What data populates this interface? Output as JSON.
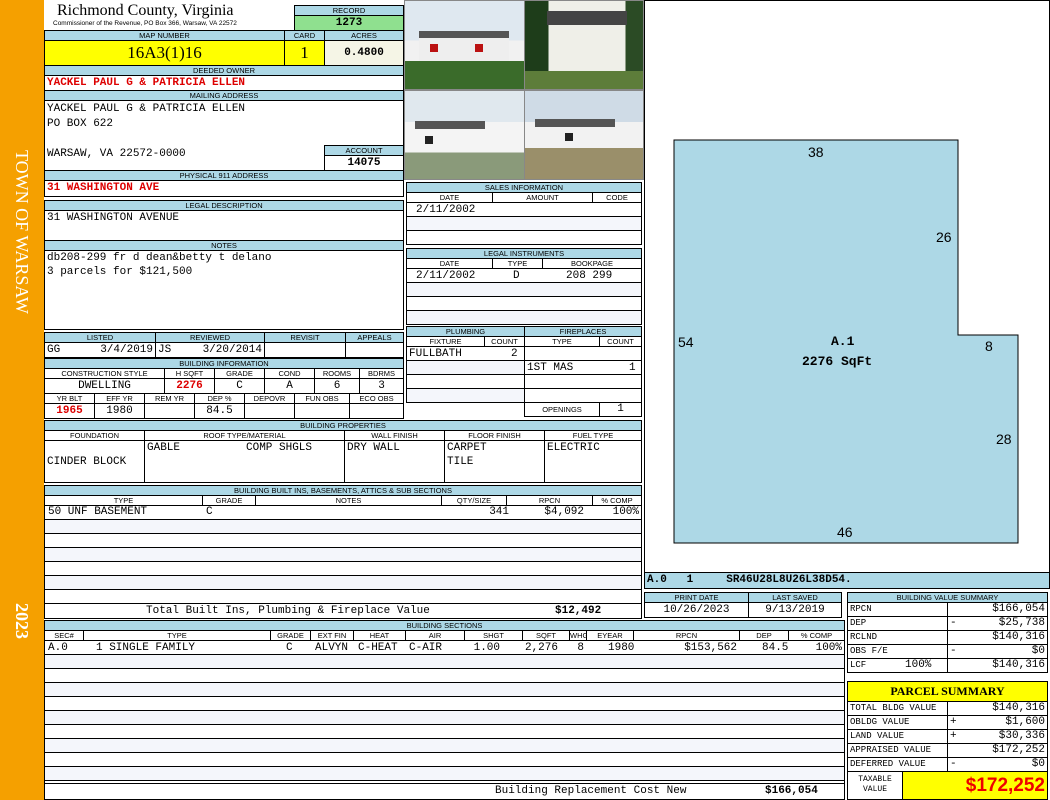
{
  "side": {
    "town": "TOWN OF WARSAW",
    "year": "2023"
  },
  "header": {
    "county": "Richmond County, Virginia",
    "office": "Commissioner of the Revenue, PO Box 366, Warsaw, VA 22572",
    "record_label": "RECORD",
    "record": "1273",
    "map_label": "MAP NUMBER",
    "map": "16A3(1)16",
    "card_label": "CARD",
    "card": "1",
    "acres_label": "ACRES",
    "acres": "0.4800"
  },
  "owner": {
    "label": "DEEDED OWNER",
    "value": "YACKEL PAUL G & PATRICIA ELLEN"
  },
  "mailing": {
    "label": "MAILING ADDRESS",
    "line1": "YACKEL PAUL G & PATRICIA ELLEN",
    "line2": "PO BOX 622",
    "line3": "WARSAW, VA 22572-0000",
    "account_label": "ACCOUNT",
    "account": "14075"
  },
  "physical": {
    "label": "PHYSICAL 911 ADDRESS",
    "value": "31 WASHINGTON AVE"
  },
  "legal": {
    "label": "LEGAL DESCRIPTION",
    "value": "31 WASHINGTON AVENUE"
  },
  "notes": {
    "label": "NOTES",
    "line1": "db208-299 fr d dean&betty t delano",
    "line2": "3 parcels for $121,500"
  },
  "listing": {
    "listed_label": "LISTED",
    "listed_by": "GG",
    "listed_date": "3/4/2019",
    "reviewed_label": "REVIEWED",
    "reviewed_by": "JS",
    "reviewed_date": "3/20/2014",
    "revisit_label": "REVISIT",
    "appeals_label": "APPEALS"
  },
  "bldg_info": {
    "label": "BUILDING INFORMATION",
    "h1": [
      "CONSTRUCTION STYLE",
      "H SQFT",
      "GRADE",
      "COND",
      "ROOMS",
      "BDRMS"
    ],
    "v1": [
      "DWELLING",
      "2276",
      "C",
      "A",
      "6",
      "3"
    ],
    "h2": [
      "YR BLT",
      "EFF YR",
      "REM YR",
      "DEP %",
      "DEPOVR",
      "FUN OBS",
      "ECO OBS"
    ],
    "v2": [
      "1965",
      "1980",
      "",
      "84.5",
      "",
      "",
      ""
    ]
  },
  "props": {
    "label": "BUILDING PROPERTIES",
    "headers": [
      "FOUNDATION",
      "ROOF TYPE/MATERIAL",
      "WALL FINISH",
      "FLOOR FINISH",
      "FUEL TYPE"
    ],
    "foundation": "CINDER BLOCK",
    "roof_type": "GABLE",
    "roof_material": "COMP SHGLS",
    "wall": "DRY WALL",
    "floor1": "CARPET",
    "floor2": "TILE",
    "fuel": "ELECTRIC"
  },
  "builtins": {
    "label": "BUILDING BUILT INS, BASEMENTS, ATTICS & SUB SECTIONS",
    "headers": [
      "TYPE",
      "GRADE",
      "NOTES",
      "QTY/SIZE",
      "RPCN",
      "% COMP"
    ],
    "row": [
      "50 UNF BASEMENT",
      "C",
      "",
      "341",
      "$4,092",
      "100%"
    ],
    "total_label": "Total Built Ins, Plumbing & Fireplace Value",
    "total": "$12,492"
  },
  "sales": {
    "label": "SALES INFORMATION",
    "headers": [
      "DATE",
      "AMOUNT",
      "CODE"
    ],
    "row": [
      "2/11/2002",
      "",
      ""
    ]
  },
  "instruments": {
    "label": "LEGAL INSTRUMENTS",
    "headers": [
      "DATE",
      "TYPE",
      "BOOKPAGE"
    ],
    "row": [
      "2/11/2002",
      "D",
      "208 299"
    ]
  },
  "plumbing": {
    "label": "PLUMBING",
    "headers": [
      "FIXTURE",
      "COUNT"
    ],
    "fixture": "FULLBATH",
    "count": "2"
  },
  "fireplaces": {
    "label": "FIREPLACES",
    "headers": [
      "TYPE",
      "COUNT"
    ],
    "type": "1ST MAS",
    "count": "1",
    "openings_label": "OPENINGS",
    "openings": "1"
  },
  "sketch": {
    "area_label": "A.1",
    "area": "2276 SqFt",
    "dims": {
      "top": "38",
      "right_upper": "26",
      "left": "54",
      "step": "8",
      "right_lower": "28",
      "bottom": "46"
    },
    "code": "A.0   1     SR46U28L8U26L38D54."
  },
  "dates": {
    "print_label": "PRINT DATE",
    "print": "10/26/2023",
    "saved_label": "LAST SAVED",
    "saved": "9/13/2019"
  },
  "sections": {
    "label": "BUILDING SECTIONS",
    "headers": [
      "SEC#",
      "TYPE",
      "GRADE",
      "EXT FIN",
      "HEAT",
      "AIR",
      "SHGT",
      "SQFT",
      "WHGT",
      "EYEAR",
      "RPCN",
      "DEP",
      "% COMP"
    ],
    "row": [
      "A.0",
      "1 SINGLE FAMILY",
      "C",
      "ALVYN",
      "C-HEAT",
      "C-AIR",
      "1.00",
      "2,276",
      "8",
      "1980",
      "$153,562",
      "84.5",
      "100%"
    ],
    "total_label": "Building Replacement Cost New",
    "total": "$166,054"
  },
  "bvs": {
    "label": "BUILDING VALUE SUMMARY",
    "rows": [
      {
        "k": "RPCN",
        "s": "",
        "v": "$166,054"
      },
      {
        "k": "DEP",
        "s": "-",
        "v": "$25,738"
      },
      {
        "k": "RCLND",
        "s": "",
        "v": "$140,316"
      },
      {
        "k": "OBS F/E",
        "s": "-",
        "v": "$0"
      },
      {
        "k": "LCF",
        "s": "",
        "v": "$140,316",
        "pct": "100%"
      }
    ]
  },
  "parcel": {
    "label": "PARCEL SUMMARY",
    "rows": [
      {
        "k": "TOTAL BLDG VALUE",
        "s": "",
        "v": "$140,316"
      },
      {
        "k": "OBLDG VALUE",
        "s": "+",
        "v": "$1,600"
      },
      {
        "k": "LAND VALUE",
        "s": "+",
        "v": "$30,336"
      },
      {
        "k": "APPRAISED VALUE",
        "s": "",
        "v": "$172,252"
      },
      {
        "k": "DEFERRED VALUE",
        "s": "-",
        "v": "$0"
      }
    ],
    "taxable_label1": "TAXABLE",
    "taxable_label2": "VALUE",
    "taxable": "$172,252"
  }
}
